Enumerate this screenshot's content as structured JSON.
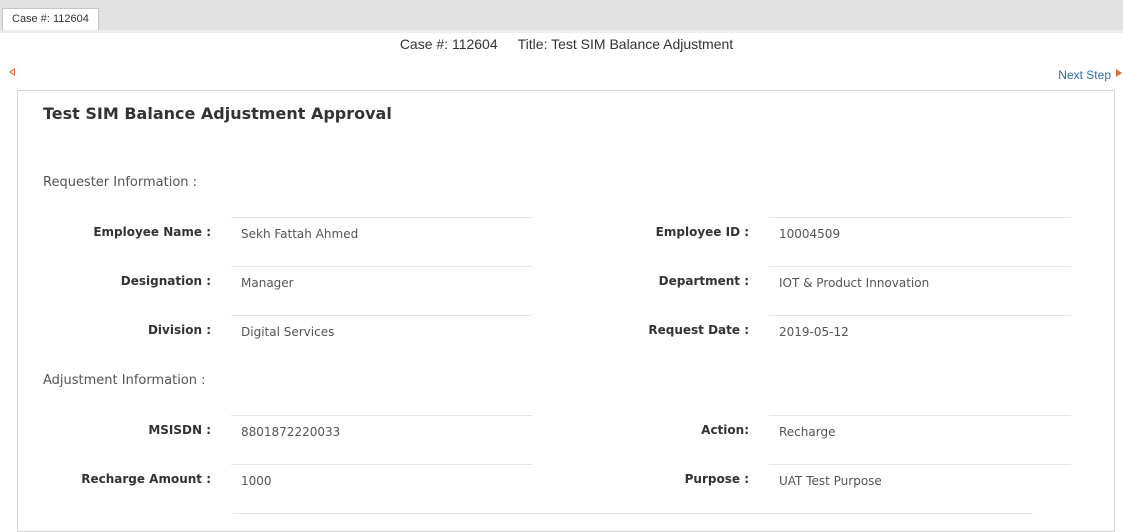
{
  "tab": {
    "label": "Case #: 112604"
  },
  "header": {
    "case_text": "Case #: 112604",
    "title_text": "Title: Test SIM Balance Adjustment"
  },
  "nav": {
    "next_label": "Next Step",
    "arrow_color": "#e46a3b",
    "link_color": "#2f6ea6"
  },
  "form": {
    "title": "Test SIM Balance Adjustment Approval",
    "requester_section": "Requester Information :",
    "adjustment_section": "Adjustment Information :",
    "fields": {
      "employee_name": {
        "label": "Employee Name :",
        "value": "Sekh Fattah Ahmed"
      },
      "employee_id": {
        "label": "Employee ID :",
        "value": "10004509"
      },
      "designation": {
        "label": "Designation :",
        "value": "Manager"
      },
      "department": {
        "label": "Department :",
        "value": "IOT & Product Innovation"
      },
      "division": {
        "label": "Division :",
        "value": "Digital Services"
      },
      "request_date": {
        "label": "Request Date :",
        "value": "2019-05-12"
      },
      "msisdn": {
        "label": "MSISDN :",
        "value": "8801872220033"
      },
      "action": {
        "label": "Action:",
        "value": "Recharge"
      },
      "recharge_amount": {
        "label": "Recharge Amount :",
        "value": "1000"
      },
      "purpose": {
        "label": "Purpose :",
        "value": "UAT Test Purpose"
      }
    }
  }
}
